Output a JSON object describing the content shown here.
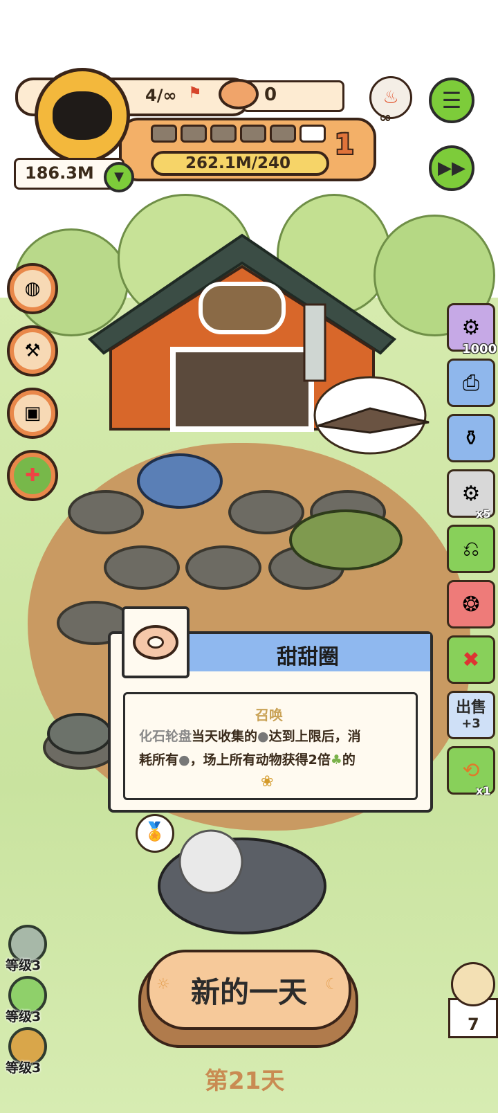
{
  "hud": {
    "animal_count": "4/∞",
    "food_bowl_count": "0",
    "coins": "186.3M",
    "progress_text": "262.1M/240",
    "level_number": "1",
    "filled_segments_fraction": 0.83
  },
  "right_items": [
    {
      "name": "fossil-wheel-item",
      "badge": "1000"
    },
    {
      "name": "camera-item",
      "badge": ""
    },
    {
      "name": "jar-item",
      "badge": ""
    },
    {
      "name": "robot-item",
      "badge": "x5"
    },
    {
      "name": "ticket-item",
      "badge": ""
    },
    {
      "name": "fire-rock-item",
      "badge": ""
    },
    {
      "name": "cancel-ticket-item",
      "badge": ""
    },
    {
      "name": "sell-button",
      "badge": "出售",
      "sub": "+3"
    },
    {
      "name": "refresh-ticket-item",
      "badge": "x1"
    }
  ],
  "popup": {
    "title": "甜甜圈",
    "section_label": "召唤",
    "line1_highlight": "化石轮盘",
    "line1": "当天收集的",
    "line1b": "达到上限后，消",
    "line2": "耗所有",
    "line2b": "，场上所有动物获得2倍",
    "line2c": "的"
  },
  "levels": [
    {
      "label": "等级3"
    },
    {
      "label": "等级3"
    },
    {
      "label": "等级3"
    }
  ],
  "new_day_button": "新的一天",
  "day_label": "第21天",
  "owl_count": "7",
  "colors": {
    "grass": "#cfe6a8",
    "dirt": "#c99a62",
    "barn": "#d8672a",
    "popup_header": "#8fb8ef",
    "button_orange": "#f6c99a"
  }
}
